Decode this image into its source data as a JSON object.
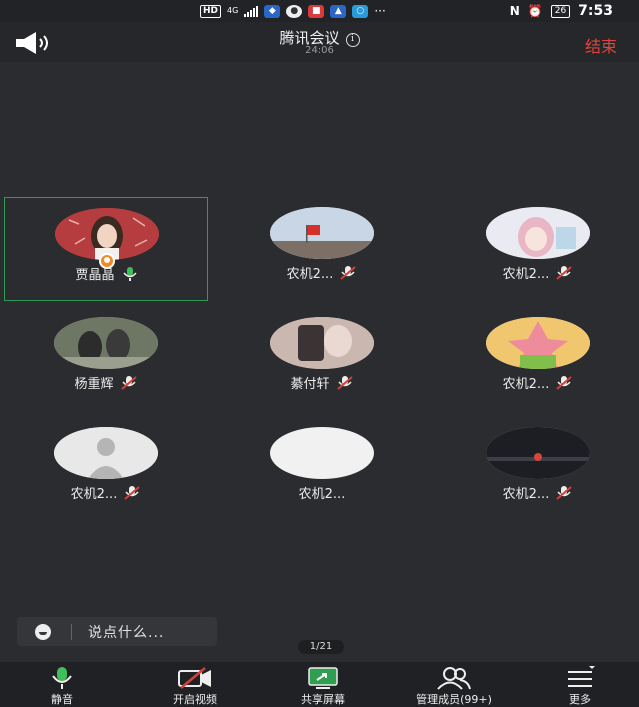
{
  "status_bar": {
    "hd_badge": "HD",
    "network": "4G",
    "battery": "26",
    "time": "7:53"
  },
  "header": {
    "title": "腾讯会议",
    "elapsed": "24:06",
    "end_label": "结束"
  },
  "participants": [
    {
      "name": "贾晶晶",
      "mic": "on",
      "host": true,
      "active": true
    },
    {
      "name": "农机2...",
      "mic": "muted"
    },
    {
      "name": "农机2...",
      "mic": "muted"
    },
    {
      "name": "杨重辉",
      "mic": "muted"
    },
    {
      "name": "綦付轩",
      "mic": "muted"
    },
    {
      "name": "农机2...",
      "mic": "muted"
    },
    {
      "name": "农机2...",
      "mic": "muted"
    },
    {
      "name": "农机2...",
      "mic": "none"
    },
    {
      "name": "农机2...",
      "mic": "muted"
    }
  ],
  "chat": {
    "placeholder": "说点什么..."
  },
  "pager": "1/21",
  "toolbar": {
    "mute_label": "静音",
    "video_label": "开启视频",
    "share_label": "共享屏幕",
    "members_label": "管理成员(99+)",
    "more_label": "更多"
  },
  "colors": {
    "background": "#2b2c2f",
    "end_red": "#e0443a",
    "mic_green": "#3fbf5a",
    "share_green": "#2f9e4f",
    "muted_red": "#d2403a",
    "active_border": "#2e9a55"
  }
}
